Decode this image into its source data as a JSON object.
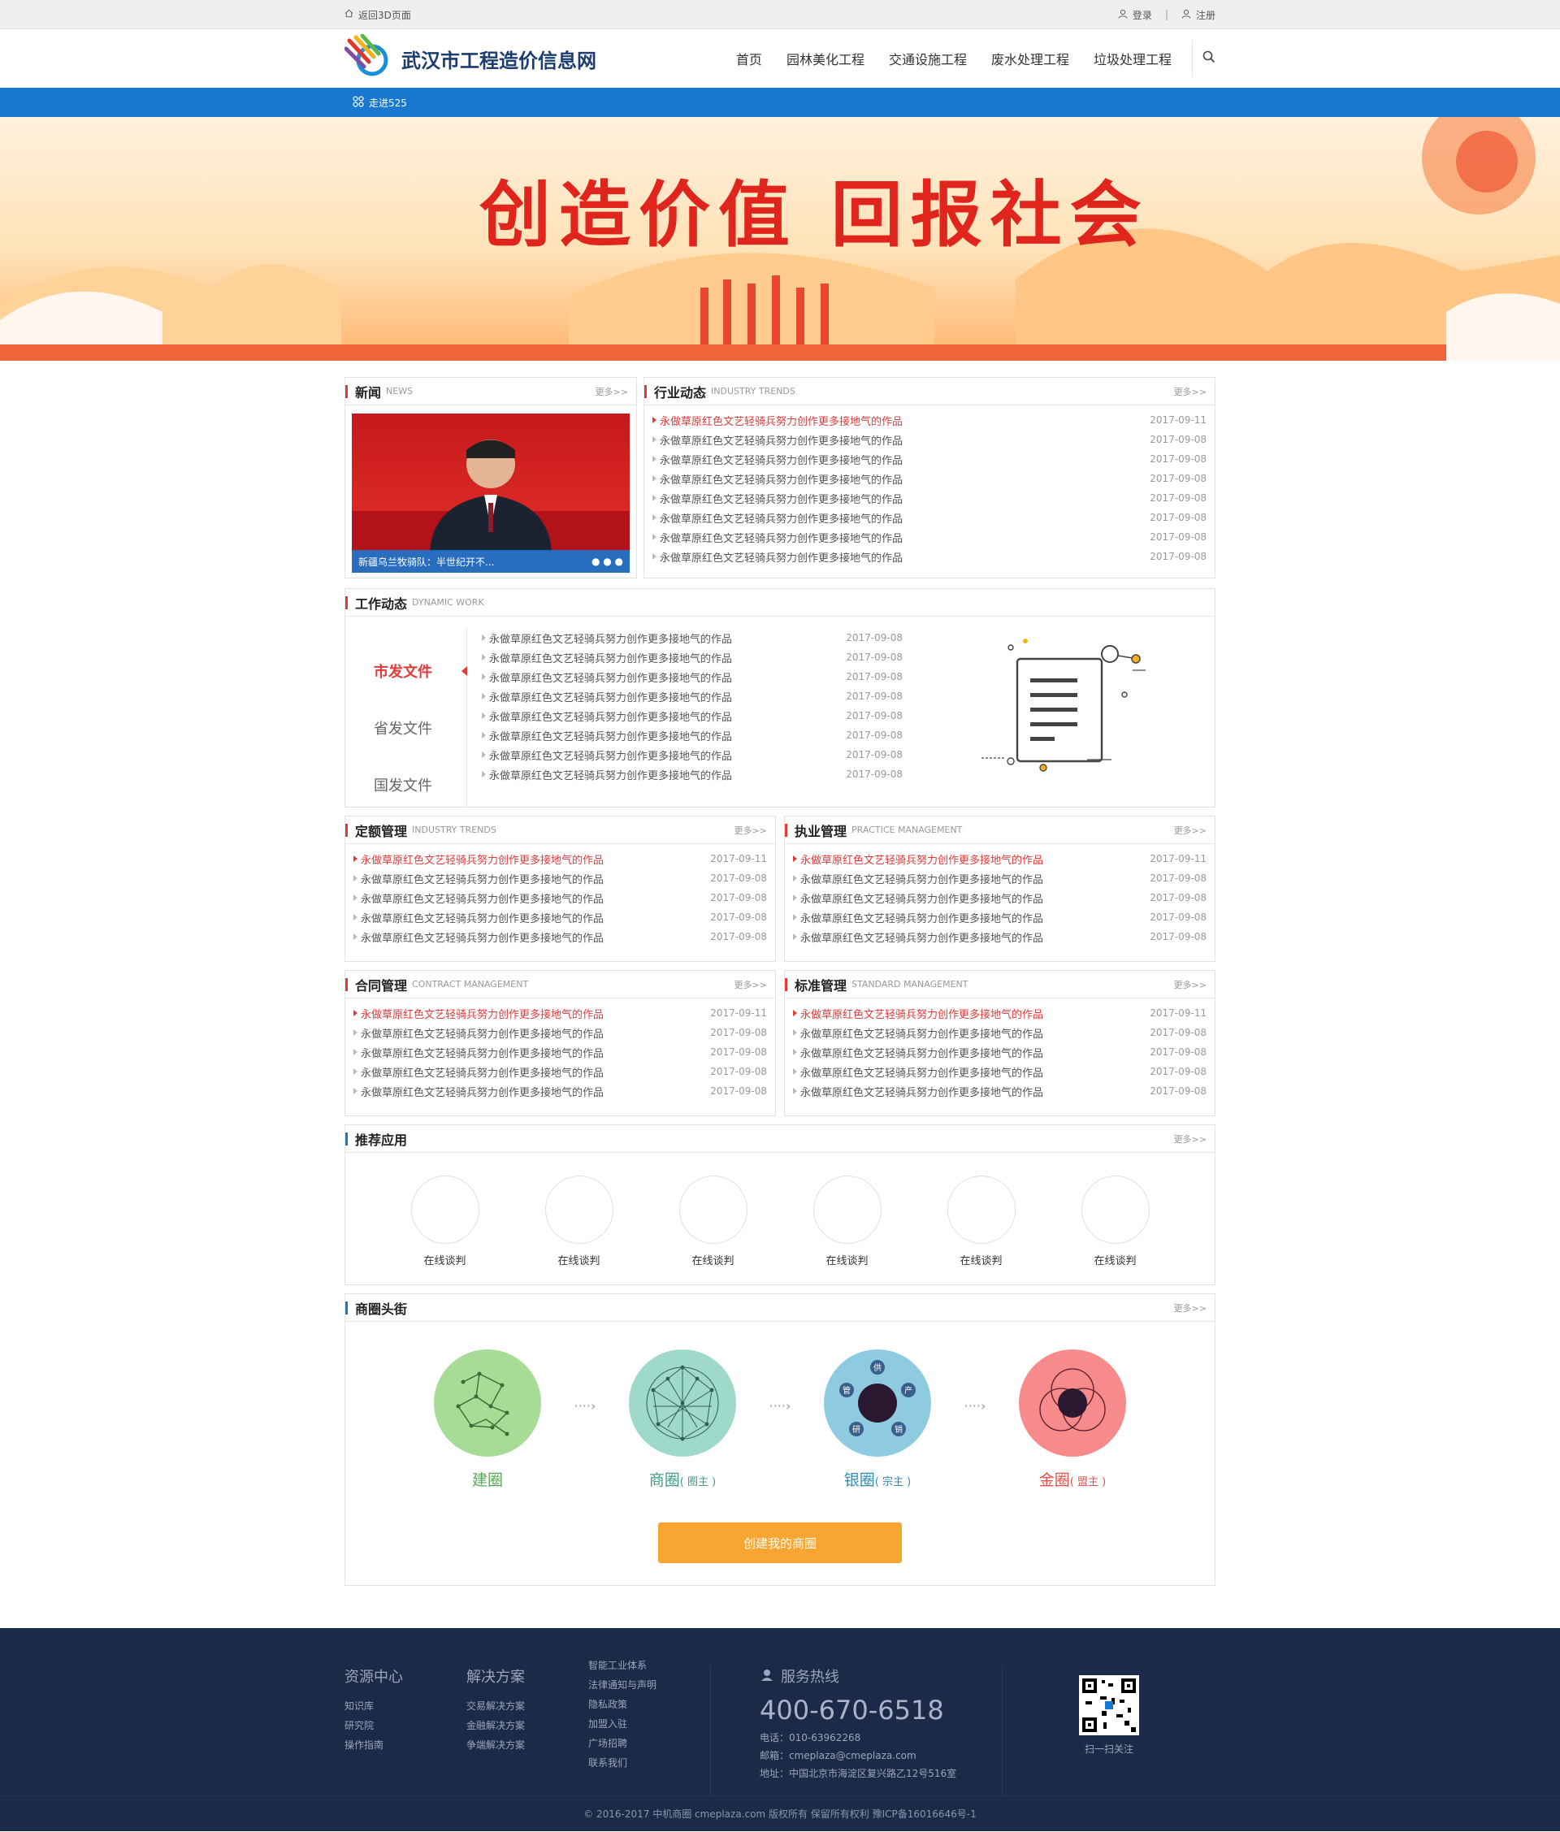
{
  "topbar": {
    "back_label": "返回3D页面",
    "login": "登录",
    "register": "注册"
  },
  "site": {
    "title": "武汉市工程造价信息网"
  },
  "nav": [
    "首页",
    "园林美化工程",
    "交通设施工程",
    "废水处理工程",
    "垃圾处理工程"
  ],
  "subbar": {
    "label": "走进525"
  },
  "banner": {
    "slogan": "创造价值 回报社会"
  },
  "news": {
    "title": "新闻",
    "en": "NEWS",
    "more": "更多>>",
    "caption": "新疆乌兰牧骑队：半世纪开不..."
  },
  "industry": {
    "title": "行业动态",
    "en": "INDUSTRY TRENDS",
    "more": "更多>>",
    "items": [
      {
        "t": "永做草原红色文艺轻骑兵努力创作更多接地气的作品",
        "d": "2017-09-11"
      },
      {
        "t": "永做草原红色文艺轻骑兵努力创作更多接地气的作品",
        "d": "2017-09-08"
      },
      {
        "t": "永做草原红色文艺轻骑兵努力创作更多接地气的作品",
        "d": "2017-09-08"
      },
      {
        "t": "永做草原红色文艺轻骑兵努力创作更多接地气的作品",
        "d": "2017-09-08"
      },
      {
        "t": "永做草原红色文艺轻骑兵努力创作更多接地气的作品",
        "d": "2017-09-08"
      },
      {
        "t": "永做草原红色文艺轻骑兵努力创作更多接地气的作品",
        "d": "2017-09-08"
      },
      {
        "t": "永做草原红色文艺轻骑兵努力创作更多接地气的作品",
        "d": "2017-09-08"
      },
      {
        "t": "永做草原红色文艺轻骑兵努力创作更多接地气的作品",
        "d": "2017-09-08"
      }
    ]
  },
  "work": {
    "title": "工作动态",
    "en": "DYNAMIC WORK",
    "tabs": [
      "市发文件",
      "省发文件",
      "国发文件"
    ],
    "items": [
      {
        "t": "永做草原红色文艺轻骑兵努力创作更多接地气的作品",
        "d": "2017-09-08"
      },
      {
        "t": "永做草原红色文艺轻骑兵努力创作更多接地气的作品",
        "d": "2017-09-08"
      },
      {
        "t": "永做草原红色文艺轻骑兵努力创作更多接地气的作品",
        "d": "2017-09-08"
      },
      {
        "t": "永做草原红色文艺轻骑兵努力创作更多接地气的作品",
        "d": "2017-09-08"
      },
      {
        "t": "永做草原红色文艺轻骑兵努力创作更多接地气的作品",
        "d": "2017-09-08"
      },
      {
        "t": "永做草原红色文艺轻骑兵努力创作更多接地气的作品",
        "d": "2017-09-08"
      },
      {
        "t": "永做草原红色文艺轻骑兵努力创作更多接地气的作品",
        "d": "2017-09-08"
      },
      {
        "t": "永做草原红色文艺轻骑兵努力创作更多接地气的作品",
        "d": "2017-09-08"
      }
    ]
  },
  "panels": [
    {
      "title": "定额管理",
      "en": "INDUSTRY TRENDS",
      "more": "更多>>"
    },
    {
      "title": "执业管理",
      "en": "PRACTICE MANAGEMENT",
      "more": "更多>>"
    },
    {
      "title": "合同管理",
      "en": "CONTRACT MANAGEMENT",
      "more": "更多>>"
    },
    {
      "title": "标准管理",
      "en": "STANDARD MANAGEMENT",
      "more": "更多>>"
    }
  ],
  "panel_items": [
    {
      "t": "永做草原红色文艺轻骑兵努力创作更多接地气的作品",
      "d": "2017-09-11"
    },
    {
      "t": "永做草原红色文艺轻骑兵努力创作更多接地气的作品",
      "d": "2017-09-08"
    },
    {
      "t": "永做草原红色文艺轻骑兵努力创作更多接地气的作品",
      "d": "2017-09-08"
    },
    {
      "t": "永做草原红色文艺轻骑兵努力创作更多接地气的作品",
      "d": "2017-09-08"
    },
    {
      "t": "永做草原红色文艺轻骑兵努力创作更多接地气的作品",
      "d": "2017-09-08"
    }
  ],
  "apps": {
    "title": "推荐应用",
    "more": "更多>>",
    "items": [
      "在线谈判",
      "在线谈判",
      "在线谈判",
      "在线谈判",
      "在线谈判",
      "在线谈判"
    ]
  },
  "circles": {
    "title": "商圈头街",
    "more": "更多>>",
    "items": [
      {
        "name": "建圈",
        "sub": "",
        "color": "#a6dc96",
        "text": "#5aa657"
      },
      {
        "name": "商圈",
        "sub": "( 圈主 )",
        "color": "#9fd9cb",
        "text": "#3f9c8a"
      },
      {
        "name": "银圈",
        "sub": "( 宗主 )",
        "color": "#8ecbe1",
        "text": "#2f8db3"
      },
      {
        "name": "金圈",
        "sub": "( 盟主 )",
        "color": "#f78a8a",
        "text": "#e0524d"
      }
    ],
    "bank_chars": [
      "供",
      "产",
      "销",
      "研",
      "管"
    ],
    "button": "创建我的商圈"
  },
  "footer": {
    "col1": {
      "title": "资源中心",
      "links": [
        "知识库",
        "研究院",
        "操作指南"
      ]
    },
    "col2": {
      "title": "解决方案",
      "links": [
        "交易解决方案",
        "金融解决方案",
        "争端解决方案"
      ]
    },
    "col3": {
      "links": [
        "智能工业体系",
        "法律通知与声明",
        "隐私政策",
        "加盟入驻",
        "广场招聘",
        "联系我们"
      ]
    },
    "hotline": {
      "title": "服务热线",
      "phone": "400-670-6518",
      "tel": "电话：010-63962268",
      "email": "邮箱：cmeplaza@cmeplaza.com",
      "addr": "地址：中国北京市海淀区复兴路乙12号516室"
    },
    "qr_label": "扫一扫关注",
    "copyright": "© 2016-2017 中机商圈 cmeplaza.com 版权所有 保留所有权利 豫ICP备16016646号-1"
  }
}
